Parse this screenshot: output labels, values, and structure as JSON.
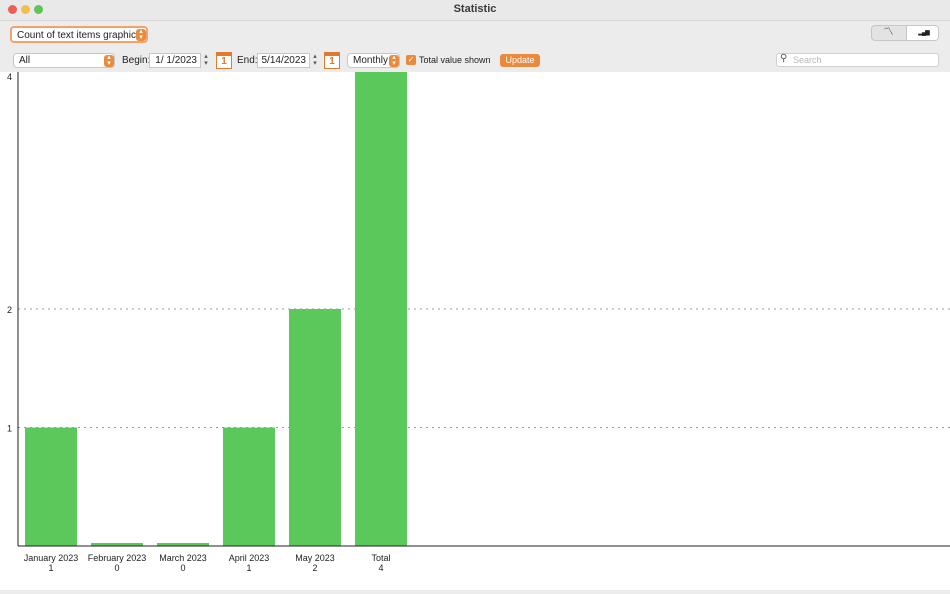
{
  "window": {
    "title": "Statistic"
  },
  "toolbar": {
    "report_select": "Count of text items graphical",
    "view_modes": [
      {
        "icon": "line-chart-icon",
        "glyph": "〽"
      },
      {
        "icon": "bar-chart-icon",
        "glyph": "▂▄▆"
      }
    ],
    "active_view": "bar-chart-icon",
    "filter_select": "All",
    "begin_label": "Begin:",
    "begin_value": "1/  1/2023",
    "end_label": "End:",
    "end_value": "5/14/2023",
    "calendar_day": "1",
    "period_select": "Monthly",
    "total_checkbox_label": "Total value shown",
    "total_checked": true,
    "update_label": "Update",
    "search_placeholder": "Search"
  },
  "chart_data": {
    "type": "bar",
    "categories": [
      "January 2023",
      "February 2023",
      "March 2023",
      "April 2023",
      "May 2023",
      "Total"
    ],
    "values": [
      1,
      0,
      0,
      1,
      2,
      4
    ],
    "value_labels": [
      "1",
      "0",
      "0",
      "1",
      "2",
      "4"
    ],
    "yticks": [
      "1",
      "2",
      "4"
    ],
    "ylim": [
      0,
      4
    ],
    "grid": "dotted horizontal at ticks",
    "bar_color": "#5ac85a"
  }
}
